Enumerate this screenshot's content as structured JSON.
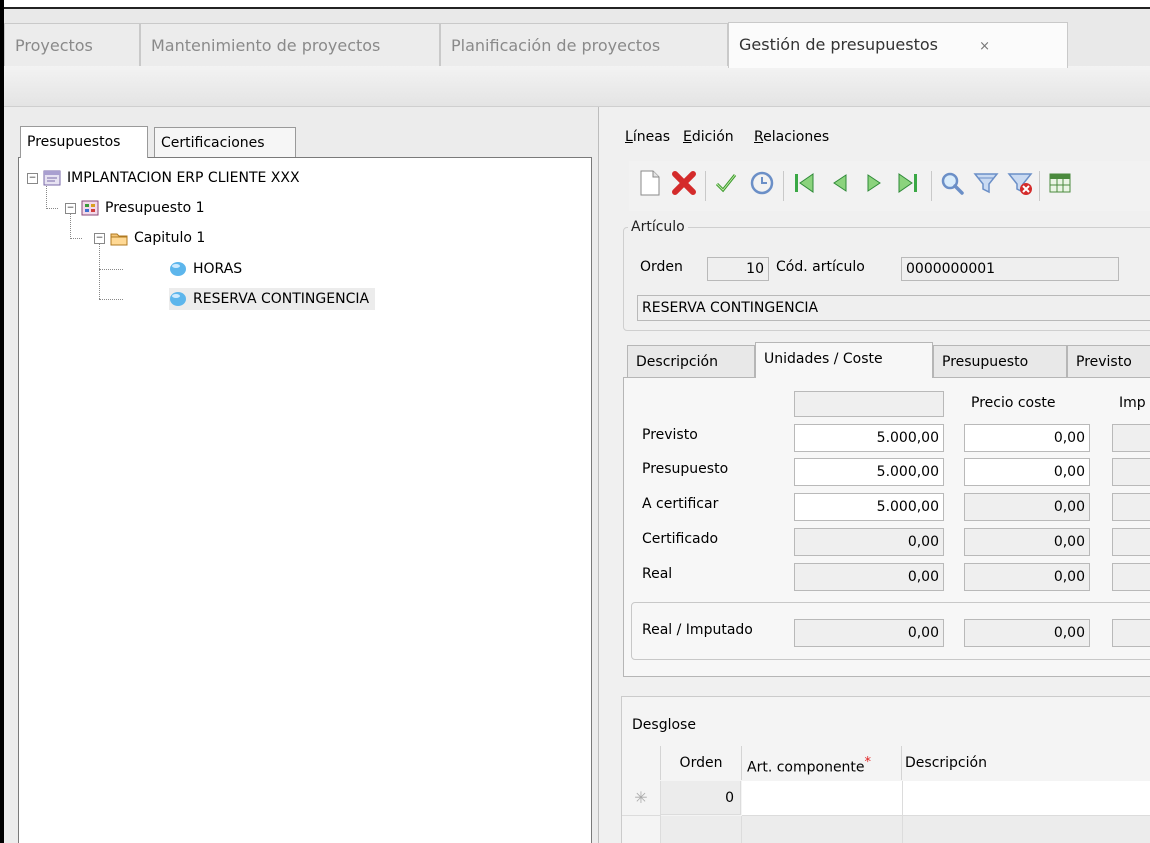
{
  "top_tabs": [
    {
      "label": "Proyectos"
    },
    {
      "label": "Mantenimiento de proyectos"
    },
    {
      "label": "Planificación de proyectos"
    },
    {
      "label": "Gestión de presupuestos",
      "close": "×"
    }
  ],
  "left": {
    "tabs": [
      "Presupuestos",
      "Certificaciones"
    ],
    "tree": [
      {
        "label": "IMPLANTACION ERP CLIENTE XXX"
      },
      {
        "label": "Presupuesto 1"
      },
      {
        "label": "Capitulo 1"
      },
      {
        "label": "HORAS"
      },
      {
        "label": "RESERVA CONTINGENCIA",
        "selected": true
      }
    ]
  },
  "menu": {
    "items": [
      {
        "prefix": "",
        "underlined": "L",
        "rest": "íneas"
      },
      {
        "prefix": "",
        "underlined": "E",
        "rest": "dición"
      },
      {
        "prefix": "",
        "underlined": "R",
        "rest": "elaciones"
      }
    ]
  },
  "toolbar": {
    "buttons": [
      "new-icon",
      "delete-icon",
      "confirm-icon",
      "undo-icon",
      "first-icon",
      "previous-icon",
      "next-icon",
      "last-icon",
      "search-icon",
      "filter-icon",
      "clear-filter-icon",
      "spreadsheet-icon"
    ]
  },
  "articulo": {
    "legend": "Artículo",
    "orden_label": "Orden",
    "orden_value": "10",
    "cod_label": "Cód. artículo",
    "cod_value": "0000000001",
    "description": "RESERVA CONTINGENCIA"
  },
  "inner_tabs": [
    "Descripción",
    "Unidades / Coste",
    "Presupuesto",
    "Previsto"
  ],
  "costs": {
    "col_headers": [
      "",
      "Precio coste",
      "Imp"
    ],
    "rows": [
      {
        "label": "Previsto",
        "units": "5.000,00",
        "price": "0,00"
      },
      {
        "label": "Presupuesto",
        "units": "5.000,00",
        "price": "0,00"
      },
      {
        "label": "A certificar",
        "units": "5.000,00",
        "price": "0,00"
      },
      {
        "label": "Certificado",
        "units": "0,00",
        "price": "0,00"
      },
      {
        "label": "Real",
        "units": "0,00",
        "price": "0,00"
      }
    ],
    "real_imputado": {
      "label": "Real / Imputado",
      "units": "0,00",
      "price": "0,00"
    }
  },
  "desglose": {
    "title": "Desglose",
    "columns": [
      "Orden",
      "Art. componente",
      "Descripción"
    ],
    "required_marker": "*",
    "new_row_marker": "✳",
    "rows": [
      {
        "orden": "0",
        "art": "",
        "desc": ""
      }
    ]
  },
  "colors": {
    "required": "#e02020",
    "delete": "#d42b2b",
    "confirm": "#3a9a2a",
    "nav": "#3aa845",
    "filter": "#6b8fc7"
  }
}
